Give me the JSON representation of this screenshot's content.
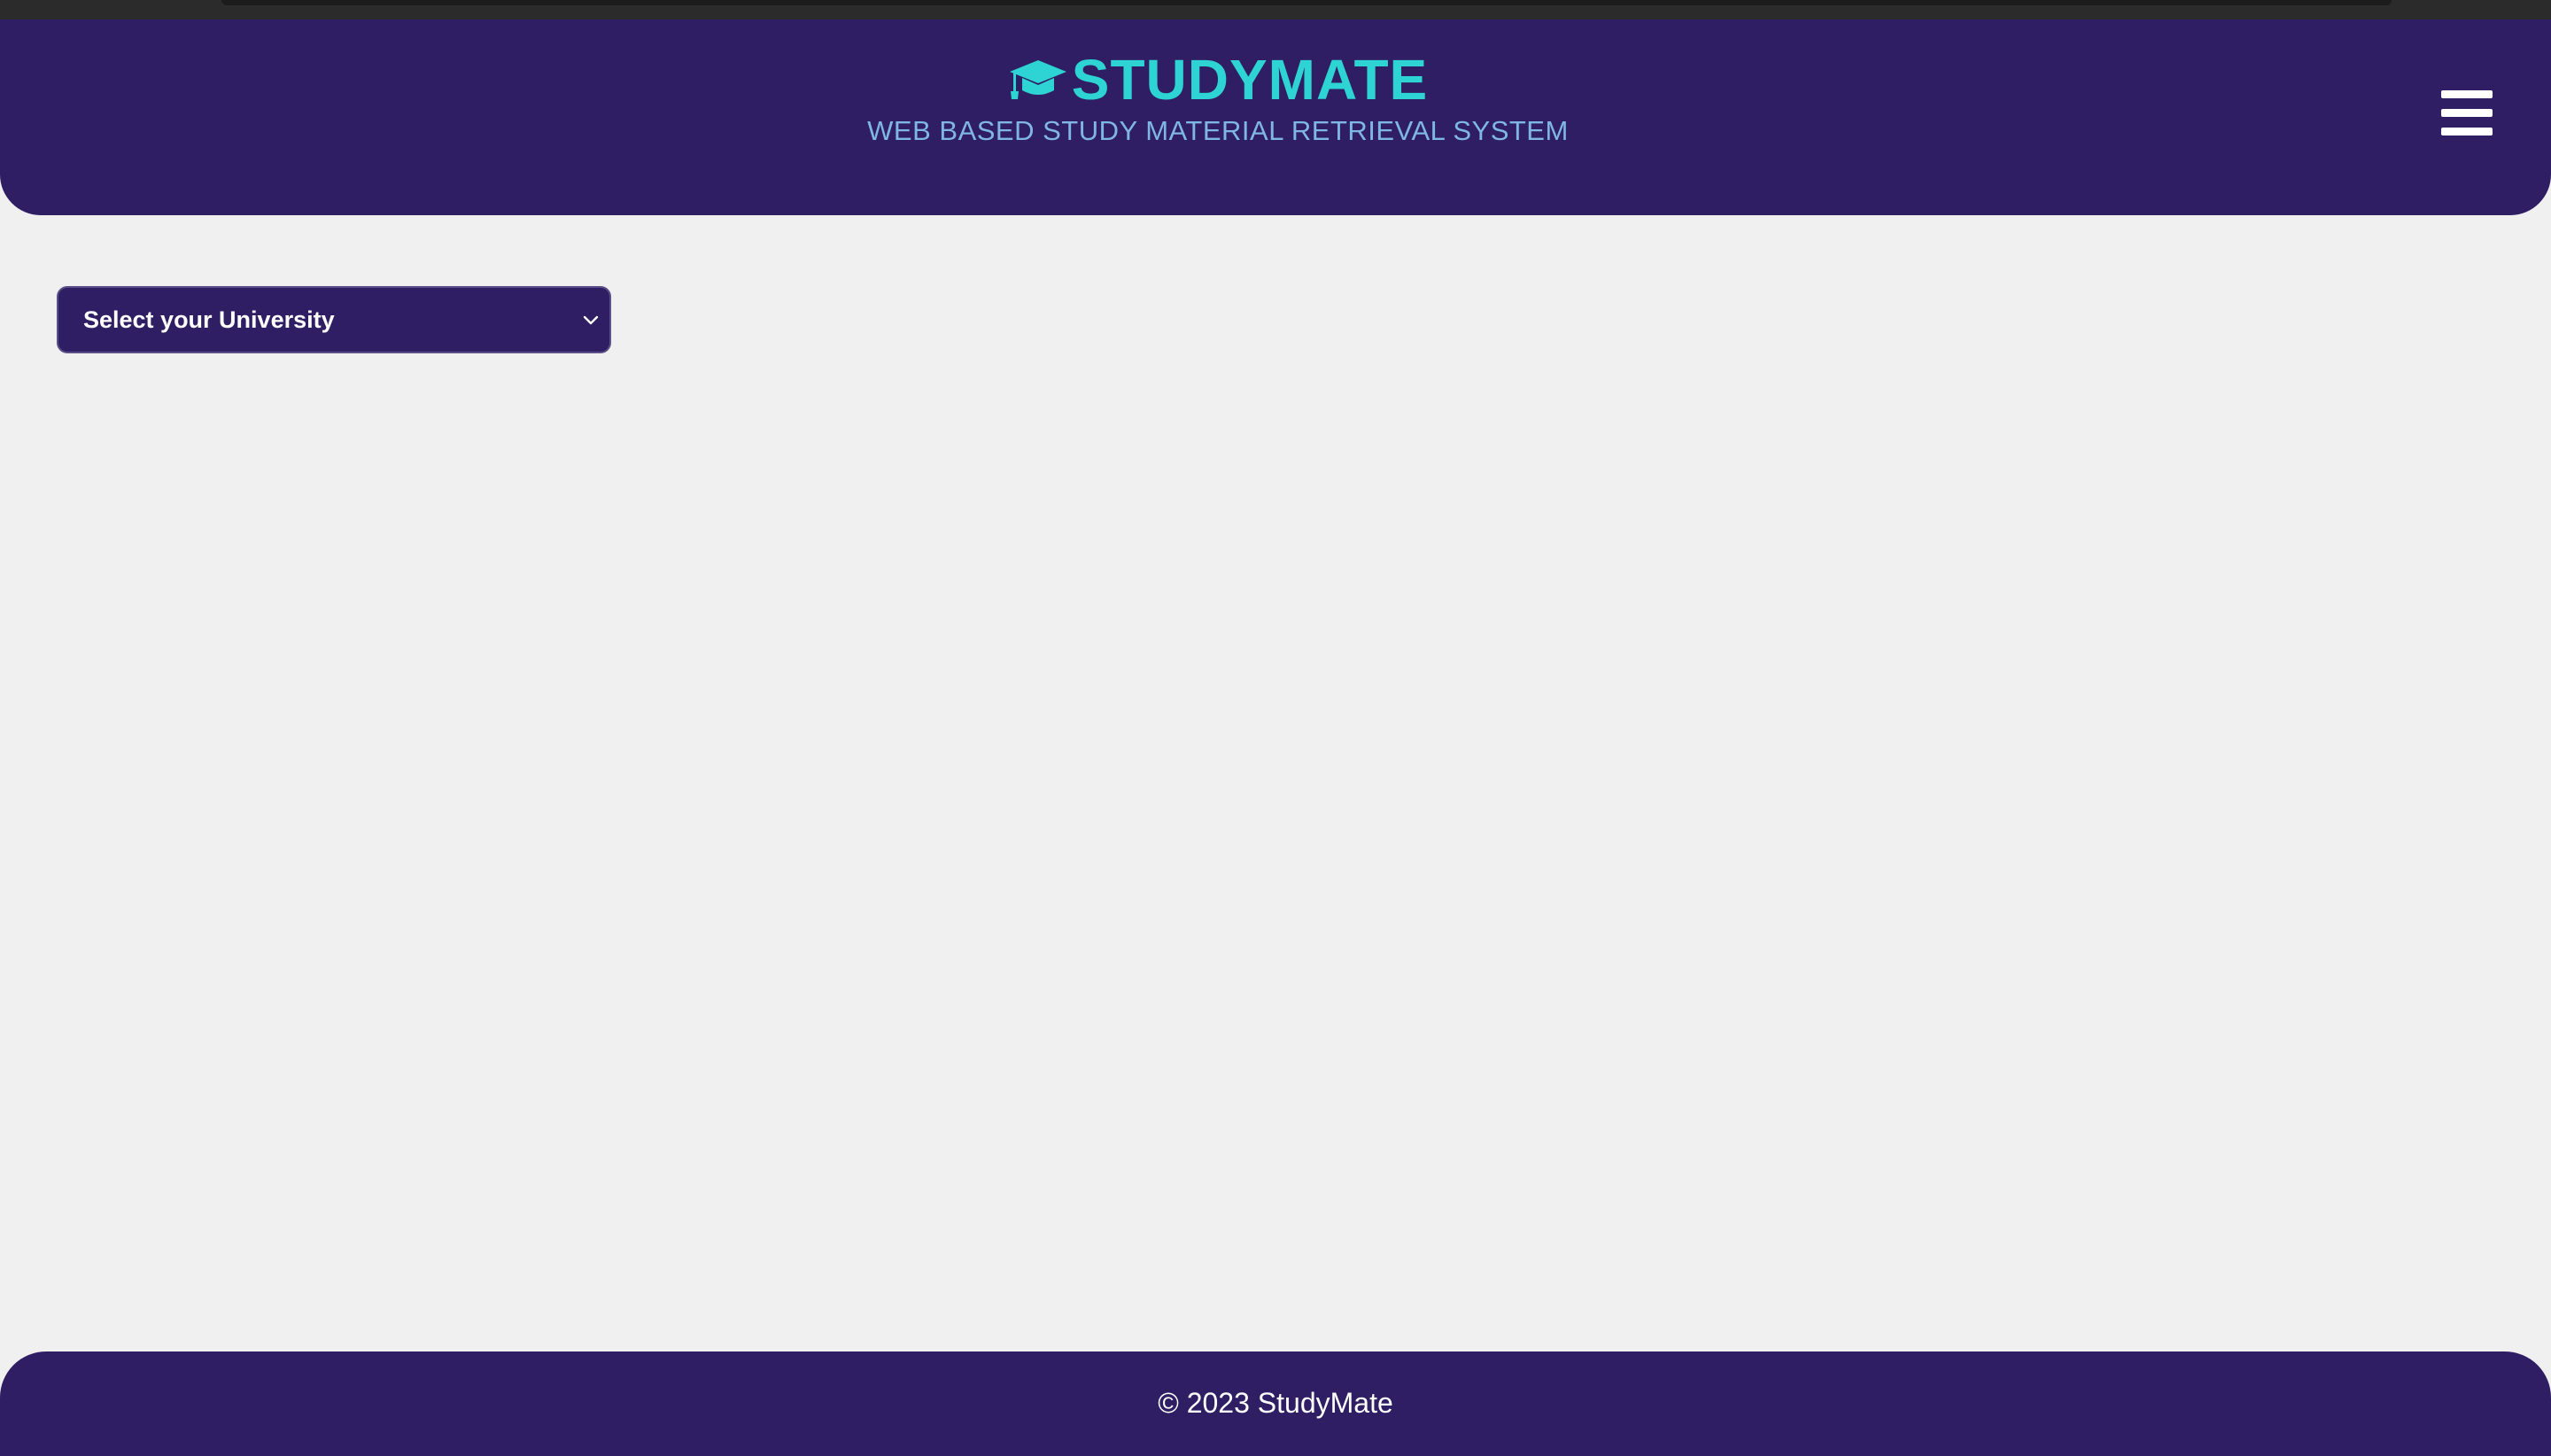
{
  "header": {
    "title": "STUDYMATE",
    "subtitle": "WEB BASED STUDY MATERIAL RETRIEVAL SYSTEM",
    "logo_icon": "graduation-cap-icon",
    "menu_icon": "hamburger-menu-icon"
  },
  "university_select": {
    "selected": "Select your University",
    "icon": "chevron-down-icon"
  },
  "footer": {
    "copyright": "© 2023 StudyMate"
  },
  "colors": {
    "primary": "#2f1e63",
    "brand_accent": "#2ed3d3",
    "subtitle": "#7fb6e6",
    "background": "#f0f0f0"
  }
}
